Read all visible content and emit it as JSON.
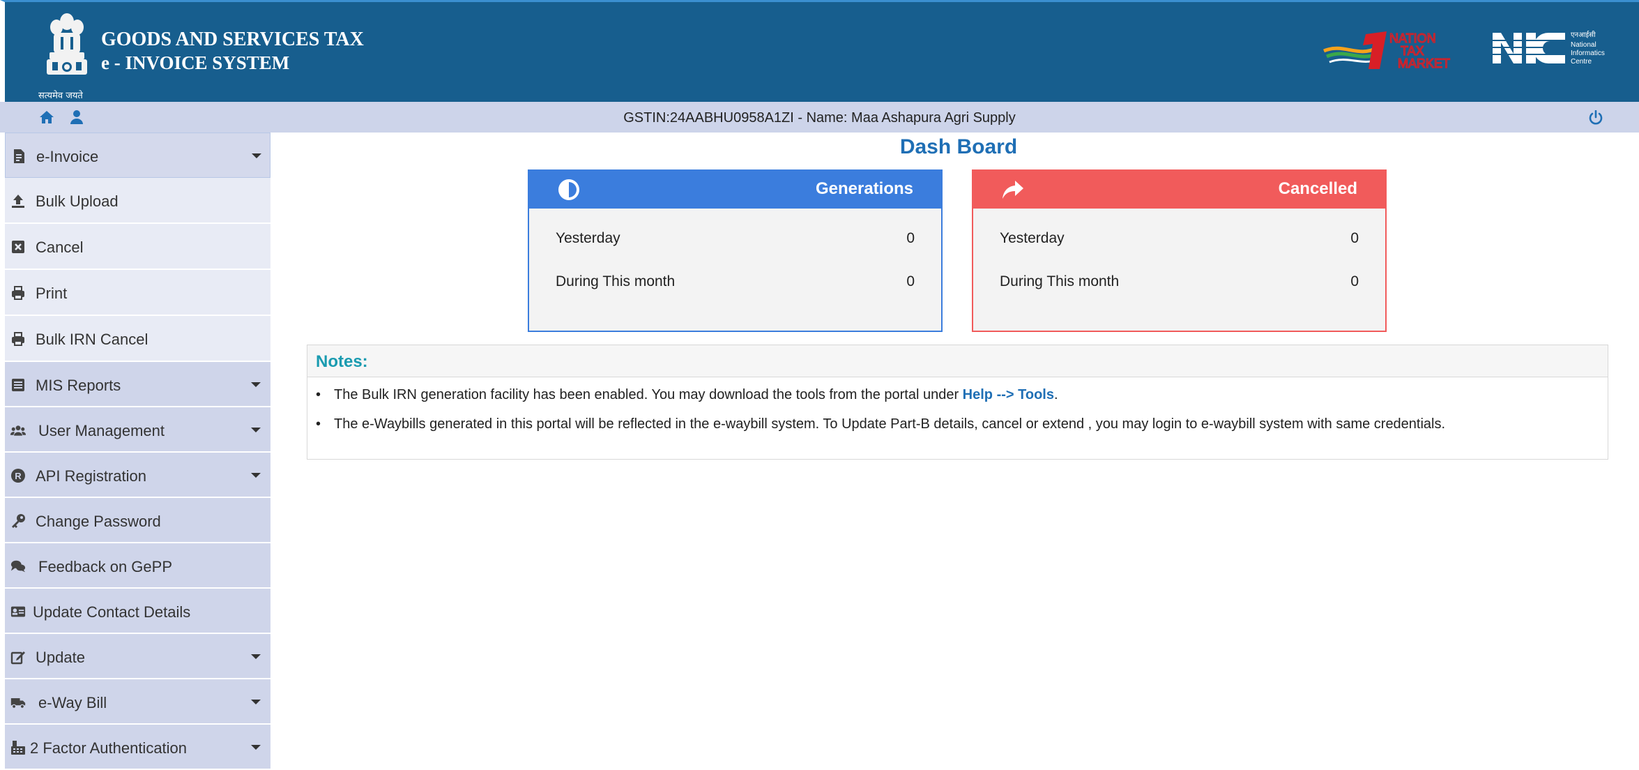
{
  "header": {
    "title_line1": "GOODS AND SERVICES TAX",
    "title_line2": "e - INVOICE SYSTEM",
    "emblem_caption": "सत्यमेव जयते",
    "emblem_icon": "national-emblem-icon",
    "partner_logo": "nation-tax-market-logo",
    "nic_logo": "nic-logo",
    "colors": {
      "bar": "#175e8e",
      "subbar": "#cdd4ea"
    }
  },
  "subbar": {
    "gstin_text": "GSTIN:24AABHU0958A1ZI - Name: Maa Ashapura Agri Supply",
    "home_icon": "home-icon",
    "user_icon": "user-icon",
    "logout_icon": "power-icon"
  },
  "sidebar": {
    "items": [
      {
        "label": "e-Invoice",
        "icon": "invoice-icon",
        "dropdown": true
      },
      {
        "label": "Bulk Upload",
        "icon": "upload-icon",
        "dropdown": false
      },
      {
        "label": "Cancel",
        "icon": "close-box-icon",
        "dropdown": false
      },
      {
        "label": "Print",
        "icon": "printer-icon",
        "dropdown": false
      },
      {
        "label": "Bulk IRN Cancel",
        "icon": "printer-icon",
        "dropdown": false
      },
      {
        "label": "MIS Reports",
        "icon": "list-icon",
        "dropdown": true
      },
      {
        "label": "User Management",
        "icon": "users-icon",
        "dropdown": true
      },
      {
        "label": "API Registration",
        "icon": "registered-icon",
        "dropdown": true
      },
      {
        "label": "Change Password",
        "icon": "key-icon",
        "dropdown": false
      },
      {
        "label": "Feedback on GePP",
        "icon": "comments-icon",
        "dropdown": false
      },
      {
        "label": "Update Contact Details",
        "icon": "id-card-icon",
        "dropdown": false
      },
      {
        "label": "Update",
        "icon": "edit-icon",
        "dropdown": true
      },
      {
        "label": "e-Way Bill",
        "icon": "truck-icon",
        "dropdown": true
      },
      {
        "label": "2 Factor Authentication",
        "icon": "fax-icon",
        "dropdown": true
      }
    ]
  },
  "dashboard": {
    "title": "Dash Board",
    "generations": {
      "title": "Generations",
      "icon": "half-circle-icon",
      "color": "#3b7ddd",
      "rows": [
        {
          "label": "Yesterday",
          "value": "0"
        },
        {
          "label": "During This month",
          "value": "0"
        }
      ]
    },
    "cancelled": {
      "title": "Cancelled",
      "icon": "share-arrow-icon",
      "color": "#f15b5b",
      "rows": [
        {
          "label": "Yesterday",
          "value": "0"
        },
        {
          "label": "During This month",
          "value": "0"
        }
      ]
    }
  },
  "notes": {
    "heading": "Notes:",
    "line1_text": "The Bulk IRN generation facility has been enabled. You may download the tools from the portal under ",
    "line1_link": "Help --> Tools",
    "line1_end": ".",
    "line2_text": "The e-Waybills generated in this portal will be reflected in the e-waybill system. To Update Part-B details, cancel or extend , you may login to e-waybill system with same credentials."
  }
}
